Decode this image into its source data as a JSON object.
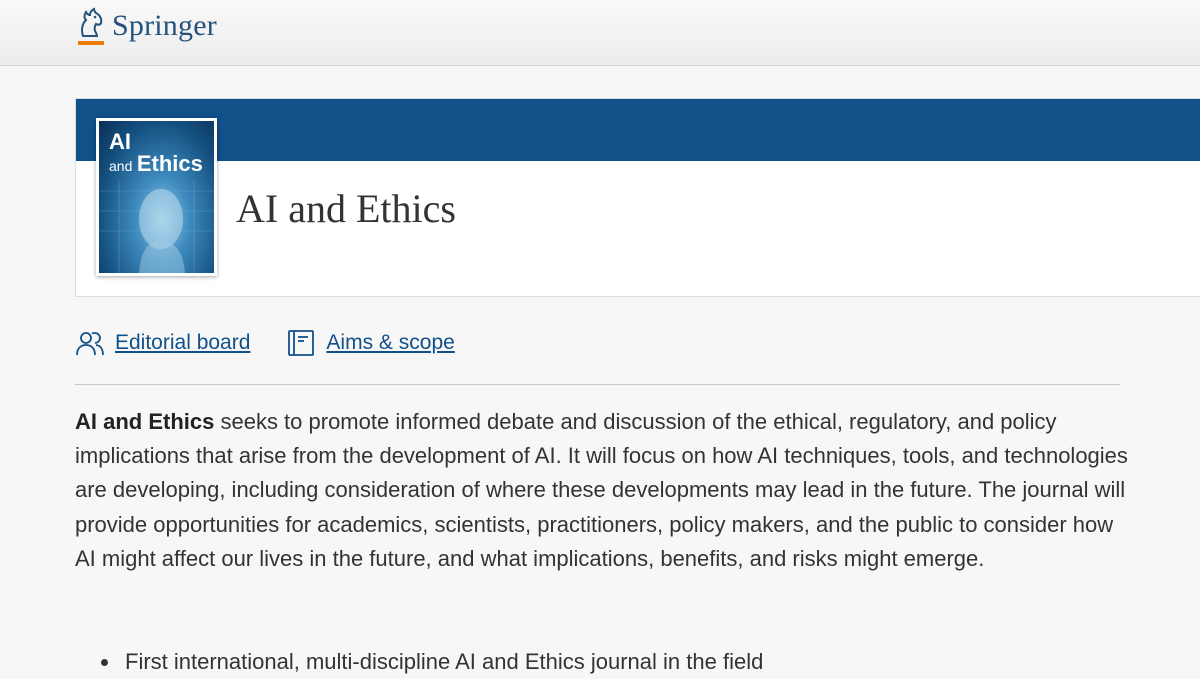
{
  "header": {
    "brand_name": "Springer",
    "logo_icon": "springer-horse-icon",
    "brand_color": "#24527a",
    "logo_accent": "#ee7d00"
  },
  "journal": {
    "title": "AI and Ethics",
    "band_color": "#12508a",
    "cover": {
      "title_line1": "AI",
      "title_line2": "and",
      "title_line3": "Ethics"
    }
  },
  "links": {
    "editorial_board": {
      "label": "Editorial board",
      "icon": "people-icon"
    },
    "aims_scope": {
      "label": "Aims & scope",
      "icon": "book-icon"
    },
    "link_color": "#12508a"
  },
  "description": {
    "lead": "AI and Ethics",
    "body": " seeks to promote informed debate and discussion of the ethical, regulatory, and policy implications that arise from the development of AI. It will focus on how AI techniques, tools, and technologies are developing, including consideration of where these developments may lead in the future. The journal will provide opportunities for academics, scientists, practitioners, policy makers, and the public to consider how AI might affect our lives in the future, and what implications, benefits, and risks might emerge."
  },
  "highlights": [
    "First international, multi-discipline AI and Ethics journal in the field"
  ]
}
